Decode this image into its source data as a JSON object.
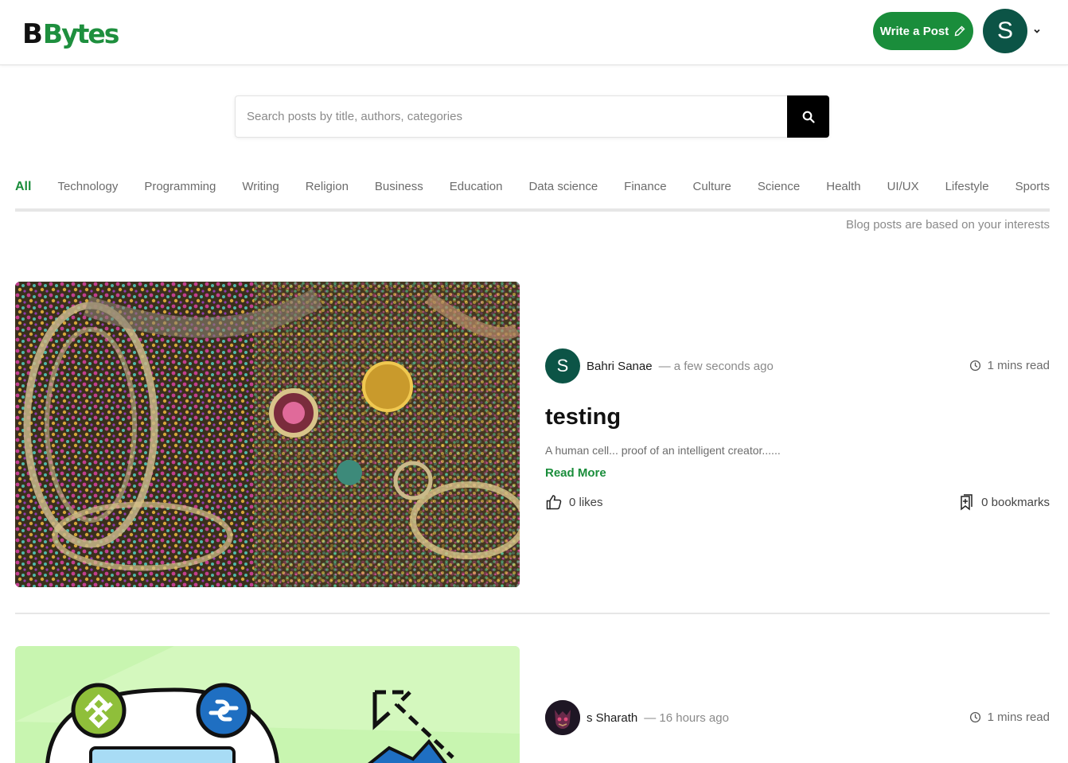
{
  "header": {
    "logo_mark": "B",
    "logo_text": "Bytes",
    "write_label": "Write a Post",
    "user_initial": "S"
  },
  "search": {
    "placeholder": "Search posts by title, authors, categories"
  },
  "categories": [
    "All",
    "Technology",
    "Programming",
    "Writing",
    "Religion",
    "Business",
    "Education",
    "Data science",
    "Finance",
    "Culture",
    "Science",
    "Health",
    "UI/UX",
    "Lifestyle",
    "Sports"
  ],
  "active_category": "All",
  "interests_note": "Blog posts are based on your interests",
  "posts": [
    {
      "author_initial": "S",
      "author": "Bahri Sanae",
      "time": "— a few seconds ago",
      "read_time": "1 mins read",
      "title": "testing",
      "excerpt": "A human cell... proof of an intelligent creator......",
      "read_more": "Read More",
      "likes": "0 likes",
      "bookmarks": "0 bookmarks"
    },
    {
      "author": "s Sharath",
      "time": "— 16 hours ago",
      "read_time": "1 mins read"
    }
  ],
  "colors": {
    "brand_green": "#1a8d3b",
    "avatar_teal": "#0c5446"
  }
}
